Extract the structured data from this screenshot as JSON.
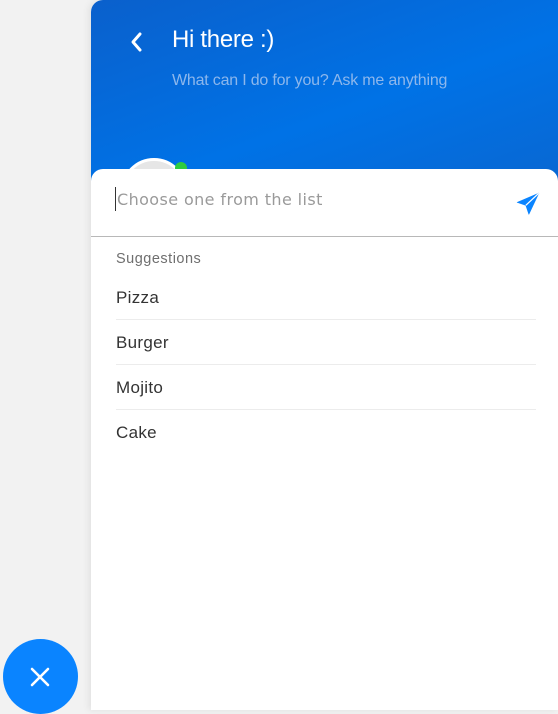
{
  "header": {
    "title": "Hi there :)",
    "subtitle": "What can I do for you? Ask me anything",
    "back_icon": "chevron-left-icon"
  },
  "composer": {
    "placeholder": "Choose one from the list",
    "value": "",
    "send_icon": "send-icon"
  },
  "suggestions": {
    "label": "Suggestions",
    "items": [
      {
        "label": "Pizza"
      },
      {
        "label": "Burger"
      },
      {
        "label": "Mojito"
      },
      {
        "label": "Cake"
      }
    ]
  },
  "fab": {
    "icon": "close-icon"
  },
  "colors": {
    "header_blue": "#0072e6",
    "accent_blue": "#0a84ff",
    "online_green": "#2ecc40"
  }
}
